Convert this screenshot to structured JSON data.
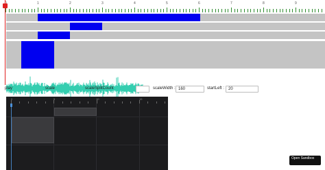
{
  "timeline": {
    "tick_labels": [
      "0",
      "1",
      "2",
      "3",
      "4",
      "5",
      "6",
      "7",
      "8",
      "9"
    ],
    "accent_color": "#0000f0",
    "track_color": "#c4c4c4",
    "cursor_color": "#e02020"
  },
  "controls": {
    "play_label": "play",
    "scale_label": "scale",
    "scale_split_count_label": "scaleSplitCount",
    "scale_width_label": "scaleWidth :",
    "scale_width_value": "160",
    "start_left_label": "startLeft :",
    "start_left_value": "20"
  },
  "dark_editor": {
    "tick_labels": [
      "0",
      "5",
      "10",
      "15"
    ],
    "background_color": "#1c1c1e"
  },
  "sandbox_button": {
    "label": "Open Sandbox"
  }
}
